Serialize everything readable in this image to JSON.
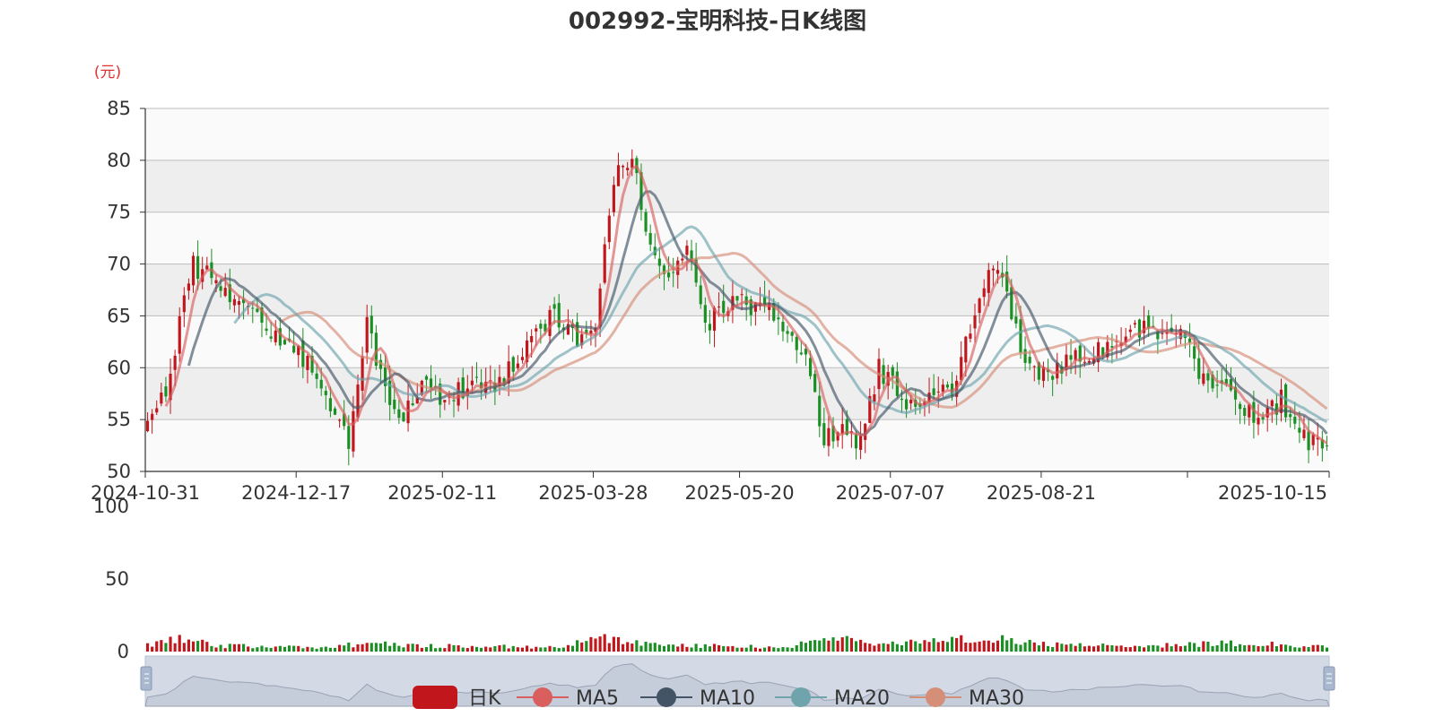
{
  "chart_data": {
    "type": "candlestick",
    "title": "002992-宝明科技-日K线图",
    "unit_label": "(元)",
    "price_axis": {
      "min": 50,
      "max": 85,
      "ticks": [
        50,
        55,
        60,
        65,
        70,
        75,
        80,
        85
      ]
    },
    "volume_axis": {
      "min": 0,
      "max": 100,
      "ticks": [
        0,
        50,
        100
      ]
    },
    "x_tick_labels": [
      "2024-10-31",
      "2024-12-17",
      "2025-02-11",
      "2025-03-28",
      "2025-05-20",
      "2025-07-07",
      "2025-08-21",
      "2025-10-15"
    ],
    "legend": [
      "日K",
      "MA5",
      "MA10",
      "MA20",
      "MA30"
    ],
    "anchors": [
      {
        "i": 0,
        "p": 54
      },
      {
        "i": 4,
        "p": 58
      },
      {
        "i": 10,
        "p": 70
      },
      {
        "i": 16,
        "p": 68
      },
      {
        "i": 22,
        "p": 66
      },
      {
        "i": 28,
        "p": 63
      },
      {
        "i": 34,
        "p": 61
      },
      {
        "i": 40,
        "p": 56
      },
      {
        "i": 44,
        "p": 53
      },
      {
        "i": 48,
        "p": 64
      },
      {
        "i": 52,
        "p": 58
      },
      {
        "i": 56,
        "p": 55
      },
      {
        "i": 60,
        "p": 58
      },
      {
        "i": 66,
        "p": 57
      },
      {
        "i": 72,
        "p": 59
      },
      {
        "i": 76,
        "p": 58
      },
      {
        "i": 82,
        "p": 62
      },
      {
        "i": 88,
        "p": 65
      },
      {
        "i": 94,
        "p": 63
      },
      {
        "i": 98,
        "p": 64
      },
      {
        "i": 102,
        "p": 78
      },
      {
        "i": 106,
        "p": 80
      },
      {
        "i": 110,
        "p": 71
      },
      {
        "i": 114,
        "p": 69
      },
      {
        "i": 118,
        "p": 72
      },
      {
        "i": 122,
        "p": 64
      },
      {
        "i": 126,
        "p": 66
      },
      {
        "i": 132,
        "p": 66
      },
      {
        "i": 138,
        "p": 65
      },
      {
        "i": 144,
        "p": 61
      },
      {
        "i": 148,
        "p": 53
      },
      {
        "i": 152,
        "p": 54
      },
      {
        "i": 156,
        "p": 53
      },
      {
        "i": 160,
        "p": 60
      },
      {
        "i": 166,
        "p": 57
      },
      {
        "i": 172,
        "p": 57
      },
      {
        "i": 176,
        "p": 58
      },
      {
        "i": 180,
        "p": 64
      },
      {
        "i": 184,
        "p": 70
      },
      {
        "i": 188,
        "p": 67
      },
      {
        "i": 192,
        "p": 60
      },
      {
        "i": 196,
        "p": 59
      },
      {
        "i": 202,
        "p": 61
      },
      {
        "i": 208,
        "p": 62
      },
      {
        "i": 214,
        "p": 63
      },
      {
        "i": 220,
        "p": 64
      },
      {
        "i": 226,
        "p": 63
      },
      {
        "i": 232,
        "p": 58
      },
      {
        "i": 238,
        "p": 57
      },
      {
        "i": 244,
        "p": 55
      },
      {
        "i": 248,
        "p": 57
      },
      {
        "i": 252,
        "p": 53
      },
      {
        "i": 256,
        "p": 53
      },
      {
        "i": 258,
        "p": 53
      }
    ],
    "volume_anchors": [
      {
        "i": 0,
        "v": 5
      },
      {
        "i": 8,
        "v": 9
      },
      {
        "i": 16,
        "v": 4
      },
      {
        "i": 40,
        "v": 3
      },
      {
        "i": 48,
        "v": 6
      },
      {
        "i": 60,
        "v": 4
      },
      {
        "i": 90,
        "v": 3
      },
      {
        "i": 100,
        "v": 10
      },
      {
        "i": 106,
        "v": 6
      },
      {
        "i": 120,
        "v": 4
      },
      {
        "i": 140,
        "v": 3
      },
      {
        "i": 150,
        "v": 10
      },
      {
        "i": 160,
        "v": 5
      },
      {
        "i": 185,
        "v": 10
      },
      {
        "i": 195,
        "v": 5
      },
      {
        "i": 215,
        "v": 4
      },
      {
        "i": 240,
        "v": 6
      },
      {
        "i": 258,
        "v": 3
      }
    ],
    "colors": {
      "up": "#c0161c",
      "down": "#1b8f24",
      "ma5": "#d95f5f",
      "ma10": "#425466",
      "ma20": "#6fa4ad",
      "ma30": "#d58e78",
      "grid_band": "#eeeeee",
      "grid_line": "#bdbdbd"
    }
  }
}
